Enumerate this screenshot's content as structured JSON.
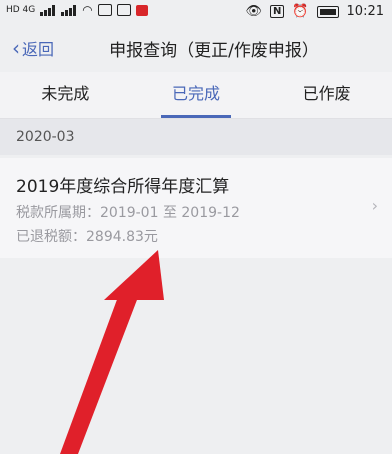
{
  "status": {
    "time": "10:21",
    "left_text": "HD 4G",
    "colors": {
      "red_icon": "#d8262a"
    }
  },
  "nav": {
    "back_label": "返回",
    "title": "申报查询（更正/作废申报）"
  },
  "tabs": [
    {
      "label": "未完成"
    },
    {
      "label": "已完成",
      "active": true
    },
    {
      "label": "已作废"
    }
  ],
  "section": {
    "label": "2020-03"
  },
  "record": {
    "title": "2019年度综合所得年度汇算",
    "period_label": "税款所属期：2019-01 至 2019-12",
    "refund_label": "已退税额：2894.83元"
  },
  "colors": {
    "accent": "#4a68b8",
    "arrow": "#e0202a",
    "background": "#eeeff1"
  }
}
